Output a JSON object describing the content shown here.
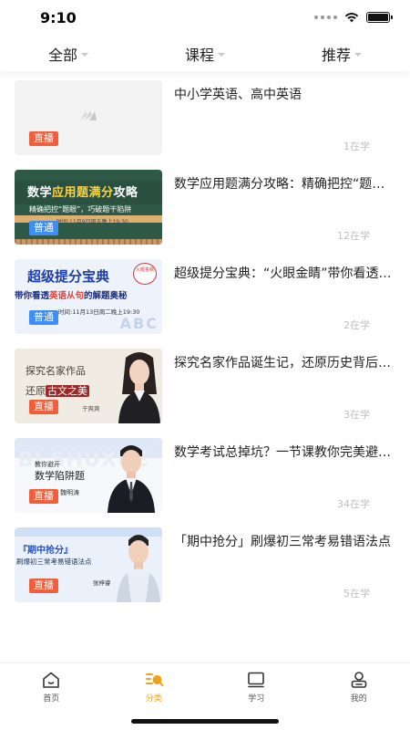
{
  "status_bar": {
    "time": "9:10"
  },
  "filters": [
    {
      "label": "全部"
    },
    {
      "label": "课程"
    },
    {
      "label": "推荐"
    }
  ],
  "courses": [
    {
      "title": "中小学英语、高中英语",
      "tag": "直播",
      "count": "1在学"
    },
    {
      "title": "数学应用题满分攻略：精确把控“题眼”，巧破题干陷阱",
      "tag": "普通",
      "count": "12在学",
      "thumb": {
        "headline_prefix": "数学",
        "headline_highlight": "应用题满分",
        "headline_suffix": "攻略",
        "subtitle": "精确把控“题眼”，巧破题干陷阱",
        "time": "时间:11月9日周五晚上19:30"
      }
    },
    {
      "title": "超级提分宝典：“火眼金睛”带你看透英语从句的解题奥秘",
      "tag": "普通",
      "count": "2在学",
      "thumb": {
        "headline": "超级提分宝典",
        "bubble": "火眼金睛",
        "sub_prefix": "带你看透",
        "sub_highlight": "英语从句",
        "sub_suffix": "的解题奥秘",
        "time": "时间:11月13日周二晚上19:30",
        "deco": "ABC"
      }
    },
    {
      "title": "探究名家作品诞生记，还原历史背后的古文之美",
      "tag": "直播",
      "count": "3在学",
      "thumb": {
        "line1": "探究名家作品",
        "line2_prefix": "还原",
        "line2_highlight": "古文之美",
        "name": "于爽爽"
      }
    },
    {
      "title": "数学考试总掉坑？一节课教你完美避开数学陷阱题",
      "tag": "直播",
      "count": "34在学",
      "thumb": {
        "watermark": "BI SHUXUE",
        "line1": "教你避开",
        "line2": "数学陷阱题",
        "name": "魏明涛"
      }
    },
    {
      "title": "「期中抢分」刷爆初三常考易错语法点",
      "tag": "直播",
      "count": "5在学",
      "thumb": {
        "headline": "『期中抢分』",
        "subtitle": "刷爆初三常考易错语法点",
        "name": "张梓睿"
      }
    }
  ],
  "tabs": [
    {
      "label": "首页",
      "icon": "home-icon",
      "active": false
    },
    {
      "label": "分类",
      "icon": "category-icon",
      "active": true
    },
    {
      "label": "学习",
      "icon": "book-icon",
      "active": false
    },
    {
      "label": "我的",
      "icon": "profile-icon",
      "active": false
    }
  ],
  "colors": {
    "accent": "#f0a020",
    "tag_live": "#ef5f3c",
    "tag_normal": "#3f8ef5"
  }
}
